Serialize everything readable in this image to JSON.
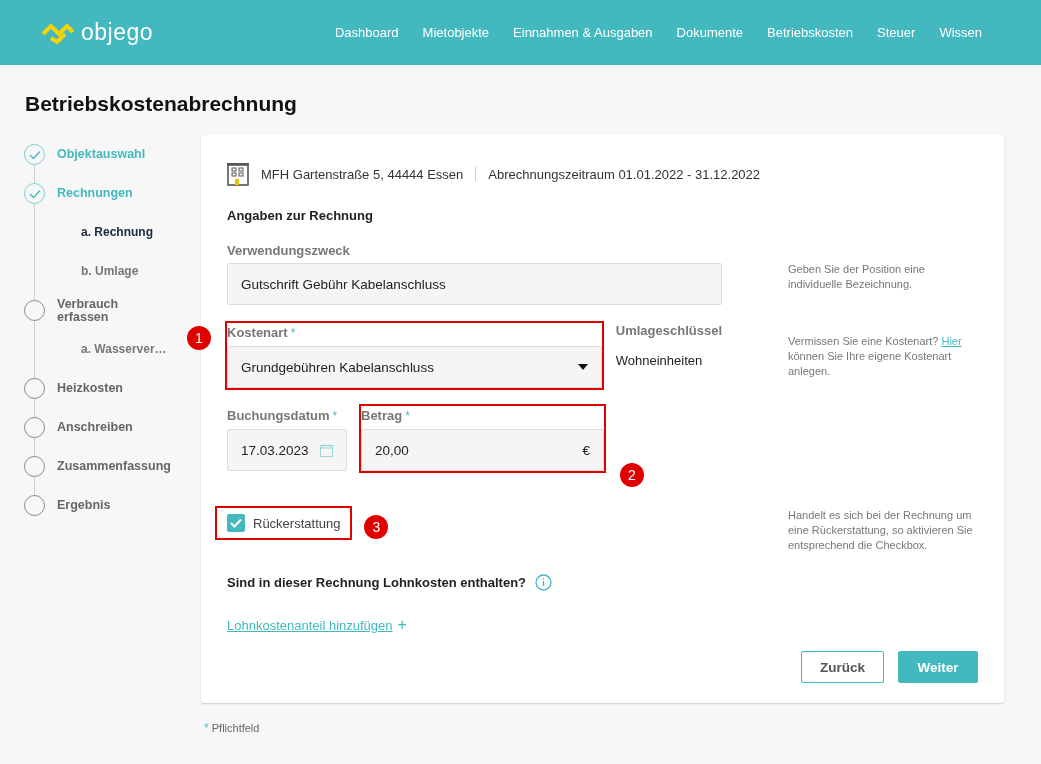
{
  "header": {
    "logo": "objego",
    "nav": [
      {
        "label": "Dashboard"
      },
      {
        "label": "Mietobjekte"
      },
      {
        "label": "Einnahmen & Ausgaben"
      },
      {
        "label": "Dokumente"
      },
      {
        "label": "Betriebskosten"
      },
      {
        "label": "Steuer"
      },
      {
        "label": "Wissen"
      }
    ]
  },
  "page_title": "Betriebskostenabrechnung",
  "steps": [
    {
      "label": "Objektauswahl",
      "completed": true
    },
    {
      "label": "Rechnungen",
      "completed": true,
      "children": [
        {
          "label": "a. Rechnung",
          "selected": true
        },
        {
          "label": "b. Umlage",
          "selected": false
        }
      ]
    },
    {
      "label": "Verbrauch erfassen",
      "completed": false,
      "children": [
        {
          "label": "a. Wasserver…",
          "selected": false
        }
      ]
    },
    {
      "label": "Heizkosten",
      "completed": false
    },
    {
      "label": "Anschreiben",
      "completed": false
    },
    {
      "label": "Zusammenfassung",
      "completed": false
    },
    {
      "label": "Ergebnis",
      "completed": false
    }
  ],
  "card": {
    "property": "MFH Gartenstraße 5, 44444 Essen",
    "period": "Abrechnungszeitraum 01.01.2022 - 31.12.2022",
    "section_title": "Angaben zur Rechnung",
    "purpose": {
      "label": "Verwendungszweck",
      "value": "Gutschrift Gebühr Kabelanschluss",
      "help": "Geben Sie der Position eine individuelle Bezeichnung."
    },
    "cost_type": {
      "label": "Kostenart",
      "required": true,
      "value": "Grundgebühren Kabelanschluss",
      "annotation": {
        "number": "1",
        "kind": "leftbadge"
      },
      "help_before": "Vermissen Sie eine Kostenart?",
      "help_link": "Hier",
      "help_after": "können Sie Ihre eigene Kostenart anlegen."
    },
    "allocation": {
      "label": "Umlageschlüssel",
      "value": "Wohneinheiten"
    },
    "booking_date": {
      "label": "Buchungsdatum",
      "required": true,
      "value": "17.03.2023"
    },
    "amount": {
      "label": "Betrag",
      "required": true,
      "value": "20,00",
      "currency": "€",
      "annotation": {
        "number": "2",
        "kind": "rightbadge"
      }
    },
    "refund": {
      "label": "Rückerstattung",
      "checked": true,
      "annotation": {
        "number": "3",
        "kind": "rightbadge"
      },
      "help": "Handelt es sich bei der Rechnung um eine Rückerstattung, so aktivieren Sie entsprechend die Checkbox."
    },
    "wage_question": "Sind in dieser Rechnung Lohnkosten enthalten?",
    "wage_link": "Lohnkostenanteil hinzufügen",
    "wage_link_icon": "+",
    "buttons": {
      "back": "Zurück",
      "next": "Weiter"
    }
  },
  "footnote": {
    "mark": "*",
    "text": "Pflichtfeld"
  }
}
